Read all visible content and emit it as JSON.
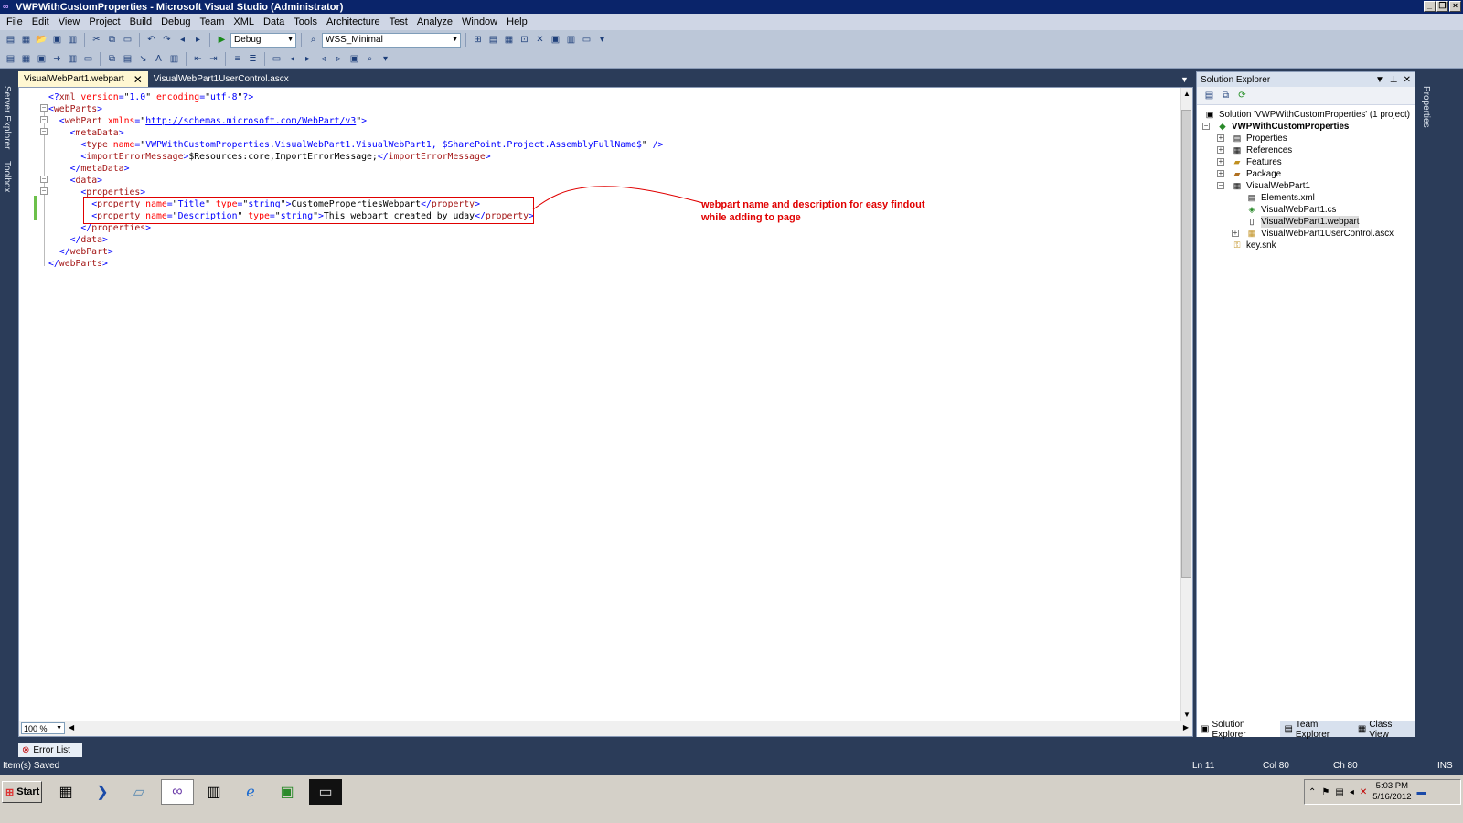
{
  "window": {
    "title": "VWPWithCustomProperties - Microsoft Visual Studio (Administrator)"
  },
  "menu": [
    "File",
    "Edit",
    "View",
    "Project",
    "Build",
    "Debug",
    "Team",
    "XML",
    "Data",
    "Tools",
    "Architecture",
    "Test",
    "Analyze",
    "Window",
    "Help"
  ],
  "toolbar": {
    "config_value": "Debug",
    "project_value": "WSS_Minimal"
  },
  "left_strip": {
    "server_explorer": "Server Explorer",
    "toolbox": "Toolbox"
  },
  "doc_tabs": [
    {
      "label": "VisualWebPart1.webpart",
      "active": true
    },
    {
      "label": "VisualWebPart1UserControl.ascx",
      "active": false
    }
  ],
  "code_lines": [
    [
      {
        "c": "blue",
        "t": "<?"
      },
      {
        "c": "red",
        "t": "xml"
      },
      {
        "c": "attr",
        "t": " version"
      },
      {
        "c": "blue",
        "t": "="
      },
      {
        "c": "txt",
        "t": "\""
      },
      {
        "c": "blue",
        "t": "1.0"
      },
      {
        "c": "txt",
        "t": "\""
      },
      {
        "c": "attr",
        "t": " encoding"
      },
      {
        "c": "blue",
        "t": "="
      },
      {
        "c": "txt",
        "t": "\""
      },
      {
        "c": "blue",
        "t": "utf-8"
      },
      {
        "c": "txt",
        "t": "\""
      },
      {
        "c": "blue",
        "t": "?>"
      }
    ],
    [
      {
        "c": "blue",
        "t": "<"
      },
      {
        "c": "red",
        "t": "webParts"
      },
      {
        "c": "blue",
        "t": ">"
      }
    ],
    [
      {
        "c": "txt",
        "t": "  "
      },
      {
        "c": "blue",
        "t": "<"
      },
      {
        "c": "red",
        "t": "webPart"
      },
      {
        "c": "attr",
        "t": " xmlns"
      },
      {
        "c": "blue",
        "t": "="
      },
      {
        "c": "txt",
        "t": "\""
      },
      {
        "c": "link",
        "t": "http://schemas.microsoft.com/WebPart/v3"
      },
      {
        "c": "txt",
        "t": "\""
      },
      {
        "c": "blue",
        "t": ">"
      }
    ],
    [
      {
        "c": "txt",
        "t": "    "
      },
      {
        "c": "blue",
        "t": "<"
      },
      {
        "c": "red",
        "t": "metaData"
      },
      {
        "c": "blue",
        "t": ">"
      }
    ],
    [
      {
        "c": "txt",
        "t": "      "
      },
      {
        "c": "blue",
        "t": "<"
      },
      {
        "c": "red",
        "t": "type"
      },
      {
        "c": "attr",
        "t": " name"
      },
      {
        "c": "blue",
        "t": "="
      },
      {
        "c": "txt",
        "t": "\""
      },
      {
        "c": "blue",
        "t": "VWPWithCustomProperties.VisualWebPart1.VisualWebPart1, $SharePoint.Project.AssemblyFullName$"
      },
      {
        "c": "txt",
        "t": "\""
      },
      {
        "c": "blue",
        "t": " />"
      }
    ],
    [
      {
        "c": "txt",
        "t": "      "
      },
      {
        "c": "blue",
        "t": "<"
      },
      {
        "c": "red",
        "t": "importErrorMessage"
      },
      {
        "c": "blue",
        "t": ">"
      },
      {
        "c": "txt",
        "t": "$Resources:core,ImportErrorMessage;"
      },
      {
        "c": "blue",
        "t": "</"
      },
      {
        "c": "red",
        "t": "importErrorMessage"
      },
      {
        "c": "blue",
        "t": ">"
      }
    ],
    [
      {
        "c": "txt",
        "t": "    "
      },
      {
        "c": "blue",
        "t": "</"
      },
      {
        "c": "red",
        "t": "metaData"
      },
      {
        "c": "blue",
        "t": ">"
      }
    ],
    [
      {
        "c": "txt",
        "t": "    "
      },
      {
        "c": "blue",
        "t": "<"
      },
      {
        "c": "red",
        "t": "data"
      },
      {
        "c": "blue",
        "t": ">"
      }
    ],
    [
      {
        "c": "txt",
        "t": "      "
      },
      {
        "c": "blue",
        "t": "<"
      },
      {
        "c": "red",
        "t": "properties"
      },
      {
        "c": "blue",
        "t": ">"
      }
    ],
    [
      {
        "c": "txt",
        "t": "        "
      },
      {
        "c": "blue",
        "t": "<"
      },
      {
        "c": "red",
        "t": "property"
      },
      {
        "c": "attr",
        "t": " name"
      },
      {
        "c": "blue",
        "t": "="
      },
      {
        "c": "txt",
        "t": "\""
      },
      {
        "c": "blue",
        "t": "Title"
      },
      {
        "c": "txt",
        "t": "\""
      },
      {
        "c": "attr",
        "t": " type"
      },
      {
        "c": "blue",
        "t": "="
      },
      {
        "c": "txt",
        "t": "\""
      },
      {
        "c": "blue",
        "t": "string"
      },
      {
        "c": "txt",
        "t": "\""
      },
      {
        "c": "blue",
        "t": ">"
      },
      {
        "c": "txt",
        "t": "CustomePropertiesWebpart"
      },
      {
        "c": "blue",
        "t": "</"
      },
      {
        "c": "red",
        "t": "property"
      },
      {
        "c": "blue",
        "t": ">"
      }
    ],
    [
      {
        "c": "txt",
        "t": "        "
      },
      {
        "c": "blue",
        "t": "<"
      },
      {
        "c": "red",
        "t": "property"
      },
      {
        "c": "attr",
        "t": " name"
      },
      {
        "c": "blue",
        "t": "="
      },
      {
        "c": "txt",
        "t": "\""
      },
      {
        "c": "blue",
        "t": "Description"
      },
      {
        "c": "txt",
        "t": "\""
      },
      {
        "c": "attr",
        "t": " type"
      },
      {
        "c": "blue",
        "t": "="
      },
      {
        "c": "txt",
        "t": "\""
      },
      {
        "c": "blue",
        "t": "string"
      },
      {
        "c": "txt",
        "t": "\""
      },
      {
        "c": "blue",
        "t": ">"
      },
      {
        "c": "txt",
        "t": "This webpart created by uday"
      },
      {
        "c": "blue",
        "t": "</"
      },
      {
        "c": "red",
        "t": "property"
      },
      {
        "c": "blue",
        "t": ">"
      }
    ],
    [
      {
        "c": "txt",
        "t": "      "
      },
      {
        "c": "blue",
        "t": "</"
      },
      {
        "c": "red",
        "t": "properties"
      },
      {
        "c": "blue",
        "t": ">"
      }
    ],
    [
      {
        "c": "txt",
        "t": "    "
      },
      {
        "c": "blue",
        "t": "</"
      },
      {
        "c": "red",
        "t": "data"
      },
      {
        "c": "blue",
        "t": ">"
      }
    ],
    [
      {
        "c": "txt",
        "t": "  "
      },
      {
        "c": "blue",
        "t": "</"
      },
      {
        "c": "red",
        "t": "webPart"
      },
      {
        "c": "blue",
        "t": ">"
      }
    ],
    [
      {
        "c": "blue",
        "t": "</"
      },
      {
        "c": "red",
        "t": "webParts"
      },
      {
        "c": "blue",
        "t": ">"
      }
    ]
  ],
  "annotation": {
    "line1": "webpart name and description for easy findout",
    "line2": "while adding to page"
  },
  "editor": {
    "zoom": "100 %"
  },
  "solution_explorer": {
    "title": "Solution Explorer",
    "solution": "Solution 'VWPWithCustomProperties' (1 project)",
    "project": "VWPWithCustomProperties",
    "items": {
      "properties": "Properties",
      "references": "References",
      "features": "Features",
      "package": "Package",
      "visualwebpart1": "VisualWebPart1",
      "elements": "Elements.xml",
      "cs": "VisualWebPart1.cs",
      "webpart": "VisualWebPart1.webpart",
      "usercontrol": "VisualWebPart1UserControl.ascx",
      "key": "key.snk"
    },
    "tabs": {
      "solution": "Solution Explorer",
      "team": "Team Explorer",
      "class": "Class View"
    }
  },
  "right_strip": {
    "properties": "Properties"
  },
  "error_list": "Error List",
  "status": {
    "message": "Item(s) Saved",
    "ln": "Ln 11",
    "col": "Col 80",
    "ch": "Ch 80",
    "ins": "INS"
  },
  "taskbar": {
    "start": "Start",
    "time": "5:03 PM",
    "date": "5/16/2012"
  },
  "colors": {
    "xml_delimiter": "#0000ff",
    "xml_element": "#a31515",
    "xml_attribute": "#ff0000",
    "annotation": "#e00000",
    "change_marker": "#6cc04a"
  }
}
